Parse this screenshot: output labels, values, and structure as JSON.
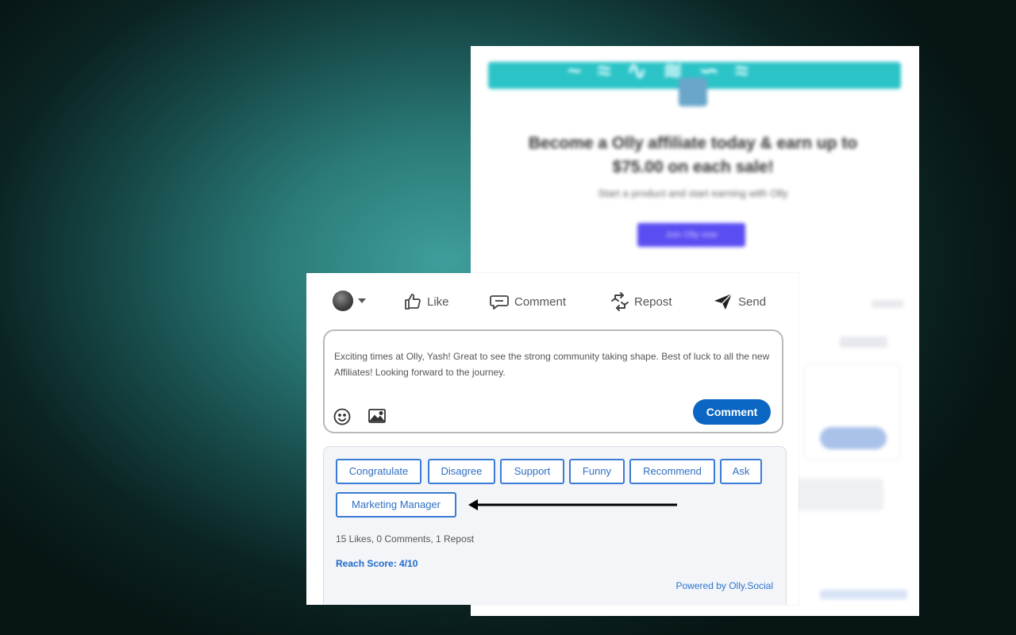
{
  "background_post": {
    "headline": "Become a Olly affiliate today & earn up to $75.00 on each sale!",
    "subtext": "Start a product and start earning with Olly",
    "cta": "Join Olly now"
  },
  "action_bar": {
    "like": "Like",
    "comment": "Comment",
    "repost": "Repost",
    "send": "Send"
  },
  "comment_box": {
    "text": "Exciting times at Olly, Yash! Great to see the strong community taking shape. Best of luck to all the new Affiliates! Looking forward to the journey.",
    "submit": "Comment"
  },
  "suggestions": {
    "chips": [
      "Congratulate",
      "Disagree",
      "Support",
      "Funny",
      "Recommend",
      "Ask",
      "Marketing Manager"
    ],
    "stats": "15 Likes, 0 Comments, 1 Repost",
    "reach": "Reach Score: 4/10",
    "powered_by": "Powered by Olly.Social"
  },
  "colors": {
    "accent": "#0a66c2",
    "chip_border": "#3a7bd5",
    "link": "#2d74cf",
    "panel_bg": "#f3f5f8"
  },
  "icons": [
    "avatar",
    "chevron-down-icon",
    "thumbs-up-icon",
    "comment-icon",
    "repost-icon",
    "send-icon",
    "emoji-icon",
    "image-icon",
    "arrow-left-icon"
  ]
}
